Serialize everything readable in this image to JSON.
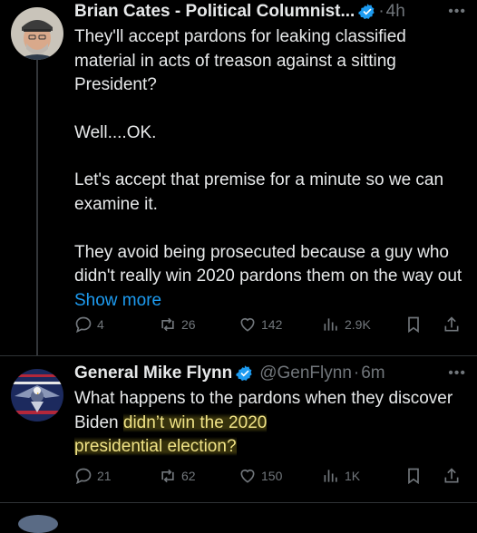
{
  "tweets": [
    {
      "author": "Brian Cates - Political Columnist...",
      "time": "4h",
      "paragraphs": [
        "They'll accept pardons for leaking classified material in acts of treason against a sitting President?",
        "Well....OK.",
        "Let's accept that premise for a minute so we can examine it.",
        "They avoid being prosecuted because a guy who didn't really win 2020 pardons them on the way out"
      ],
      "show_more": "Show more",
      "stats": {
        "replies": "4",
        "reposts": "26",
        "likes": "142",
        "views": "2.9K"
      }
    },
    {
      "author": "General Mike Flynn",
      "handle": "@GenFlynn",
      "time": "6m",
      "text_plain": "What happens to the pardons when they discover Biden ",
      "text_highlight_1": "didn’t win the 2020",
      "text_highlight_2": "presidential election?",
      "stats": {
        "replies": "21",
        "reposts": "62",
        "likes": "150",
        "views": "1K"
      }
    }
  ],
  "colors": {
    "background": "#000000",
    "text": "#e7e9ea",
    "muted": "#71767b",
    "link": "#1d9bf0",
    "highlight": "#f1e487"
  }
}
